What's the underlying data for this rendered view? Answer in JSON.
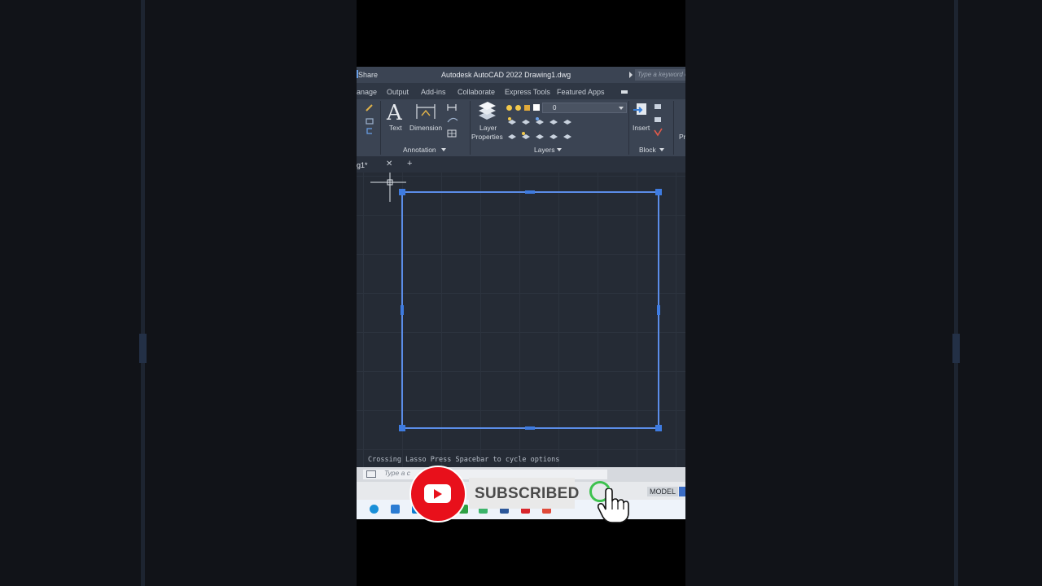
{
  "titlebar": {
    "share": "Share",
    "title": "Autodesk AutoCAD 2022    Drawing1.dwg",
    "search_placeholder": "Type a keyword or phrase"
  },
  "ribbon_tabs": [
    "anage",
    "Output",
    "Add-ins",
    "Collaborate",
    "Express Tools",
    "Featured Apps"
  ],
  "ribbon": {
    "text_label": "Text",
    "dimension_label": "Dimension",
    "layer_properties_line1": "Layer",
    "layer_properties_line2": "Properties",
    "layer_current": "0",
    "insert_label": "Insert",
    "cut_label": "Pr",
    "panels": {
      "annotation": "Annotation",
      "layers": "Layers",
      "block": "Block"
    }
  },
  "document_tab": {
    "name": "g1*"
  },
  "command": {
    "message": "Crossing Lasso  Press Spacebar to cycle options",
    "placeholder": "Type a c"
  },
  "status": {
    "model": "MODEL"
  },
  "overlay": {
    "subscribed": "SUBSCRIBED"
  },
  "icons": [
    "play-icon",
    "hand-cursor-icon",
    "crosshair-icon"
  ]
}
